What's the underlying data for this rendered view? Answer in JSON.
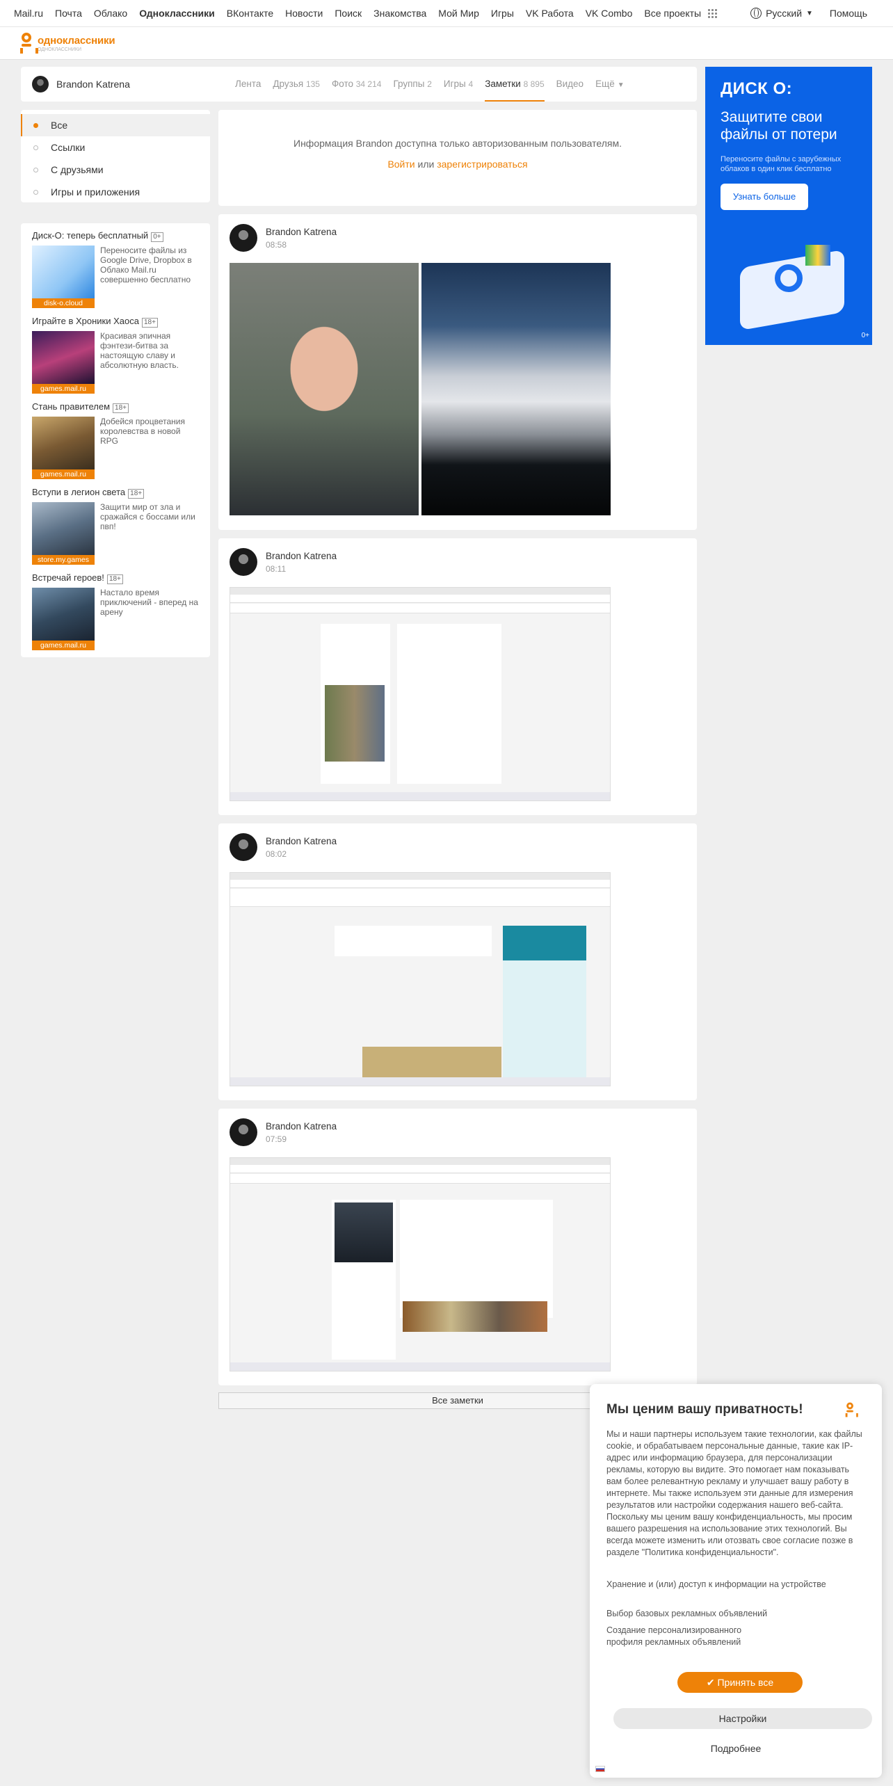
{
  "topnav": {
    "links": [
      "Mail.ru",
      "Почта",
      "Облако",
      "Одноклассники",
      "ВКонтакте",
      "Новости",
      "Поиск",
      "Знакомства",
      "Мой Мир",
      "Игры",
      "VK Работа",
      "VK Combo",
      "Все проекты"
    ],
    "language": "Русский",
    "help": "Помощь"
  },
  "logo": {
    "name": "одноклассники",
    "tagline": "ОДНОКЛАССНИКИ"
  },
  "profile": {
    "name": "Brandon Katrena",
    "tabs": [
      {
        "label": "Лента",
        "count": ""
      },
      {
        "label": "Друзья",
        "count": "135"
      },
      {
        "label": "Фото",
        "count": "34 214"
      },
      {
        "label": "Группы",
        "count": "2"
      },
      {
        "label": "Игры",
        "count": "4"
      },
      {
        "label": "Заметки",
        "count": "8 895"
      },
      {
        "label": "Видео",
        "count": ""
      },
      {
        "label": "Ещё",
        "count": ""
      }
    ]
  },
  "leftmenu": [
    "Все",
    "Ссылки",
    "С друзьями",
    "Игры и приложения"
  ],
  "ads": [
    {
      "title": "Диск-О: теперь бесплатный",
      "age": "0+",
      "text": "Переносите файлы из Google Drive, Dropbox в Облако Mail.ru совершенно бесплатно",
      "source": "disk-o.cloud"
    },
    {
      "title": "Играйте в Хроники Хаоса",
      "age": "18+",
      "text": "Красивая эпичная фэнтези-битва за настоящую славу и абсолютную власть.",
      "source": "games.mail.ru"
    },
    {
      "title": "Стань правителем",
      "age": "18+",
      "text": "Добейся процветания королевства в новой RPG",
      "source": "games.mail.ru"
    },
    {
      "title": "Вступи в легион света",
      "age": "18+",
      "text": "Защити мир от зла и сражайся с боссами или пвп!",
      "source": "store.my.games"
    },
    {
      "title": "Встречай героев!",
      "age": "18+",
      "text": "Настало время приключений - вперед на арену",
      "source": "games.mail.ru"
    }
  ],
  "notice": {
    "text": "Информация Brandon доступна только авторизованным пользователям.",
    "login": "Войти",
    "or": " или ",
    "register": "зарегистрироваться"
  },
  "posts": [
    {
      "author": "Brandon Katrena",
      "time": "08:58"
    },
    {
      "author": "Brandon Katrena",
      "time": "08:11"
    },
    {
      "author": "Brandon Katrena",
      "time": "08:02"
    },
    {
      "author": "Brandon Katrena",
      "time": "07:59"
    }
  ],
  "all_notes": "Все заметки",
  "banner": {
    "logo": "ДИСК О:",
    "headline": "Защитите свои файлы от потери",
    "sub": "Переносите файлы с зарубежных облаков в один клик бесплатно",
    "button": "Узнать больше",
    "age": "0+"
  },
  "cookie": {
    "title": "Мы ценим вашу приватность!",
    "body": "Мы и наши партнеры используем такие технологии, как файлы cookie, и обрабатываем персональные данные, такие как IP-адрес или информацию браузера, для персонализации рекламы, которую вы видите. Это помогает нам показывать вам более релевантную рекламу и улучшает вашу работу в интернете. Мы также используем эти данные для измерения результатов или настройки содержания нашего веб-сайта. Поскольку мы ценим вашу конфиденциальность, мы просим вашего разрешения на использование этих технологий. Вы всегда можете изменить или отозвать свое согласие позже в разделе \"Политика конфиденциальности\".",
    "options": [
      "Хранение и (или) доступ к информации на устройстве",
      "Выбор базовых рекламных объявлений",
      "Создание персонализированного профиля рекламных объявлений"
    ],
    "accept": "Принять все",
    "settings": "Настройки",
    "more": "Подробнее"
  },
  "colors": {
    "accent": "#ee8208",
    "banner": "#0b63e6"
  }
}
